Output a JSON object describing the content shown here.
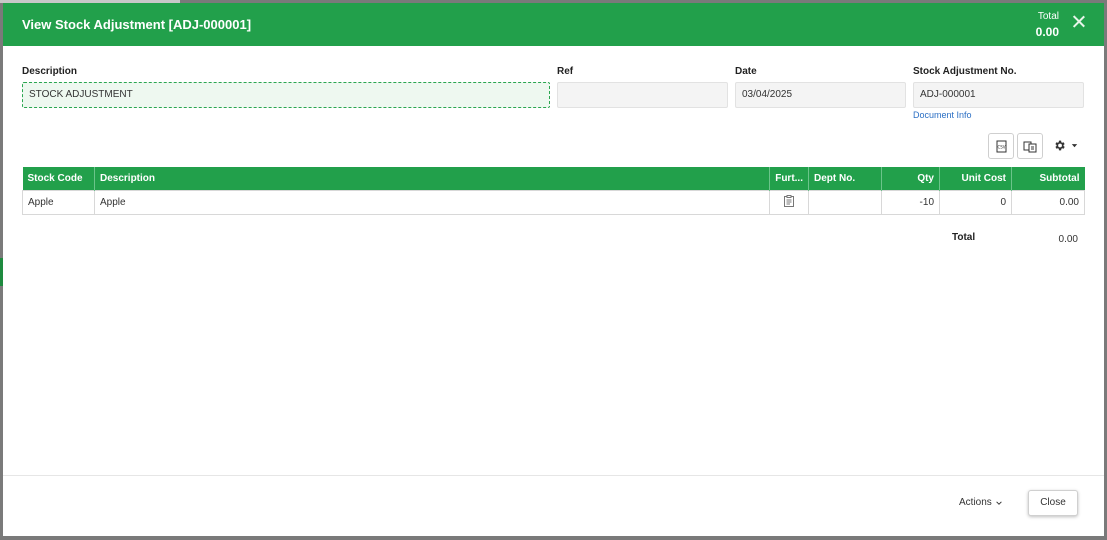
{
  "modal": {
    "title": "View Stock Adjustment [ADJ-000001]",
    "total_label": "Total",
    "total_value": "0.00"
  },
  "form": {
    "description_label": "Description",
    "description_value": "STOCK ADJUSTMENT",
    "ref_label": "Ref",
    "ref_value": "",
    "date_label": "Date",
    "date_value": "03/04/2025",
    "adj_no_label": "Stock Adjustment No.",
    "adj_no_value": "ADJ-000001",
    "document_info_link": "Document Info"
  },
  "toolbar": {
    "icons": [
      "export-icon",
      "columns-icon",
      "gear-icon"
    ]
  },
  "table": {
    "headers": {
      "stock_code": "Stock Code",
      "description": "Description",
      "further": "Furt...",
      "dept_no": "Dept No.",
      "qty": "Qty",
      "unit_cost": "Unit Cost",
      "subtotal": "Subtotal"
    },
    "rows": [
      {
        "stock_code": "Apple",
        "description": "Apple",
        "further_icon": "clipboard-icon",
        "dept_no": "",
        "qty": "-10",
        "unit_cost": "0",
        "subtotal": "0.00"
      }
    ],
    "total_label": "Total",
    "total_value": "0.00"
  },
  "footer": {
    "actions_label": "Actions",
    "close_label": "Close"
  },
  "colors": {
    "accent": "#22a04b",
    "link": "#2b6fc4"
  }
}
